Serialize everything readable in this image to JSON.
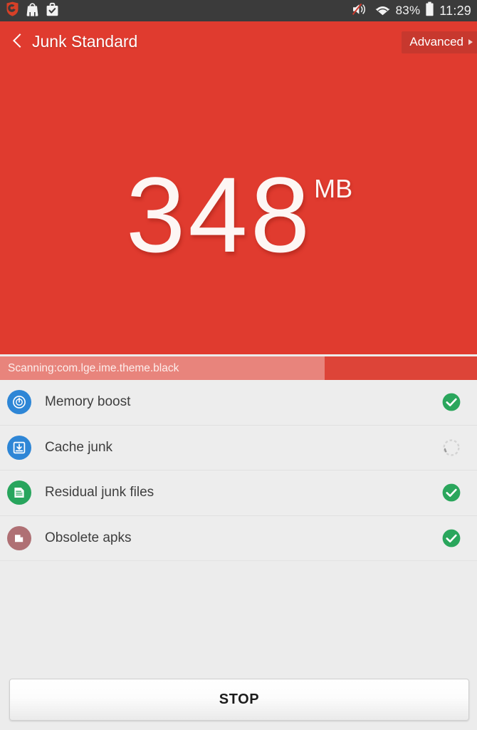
{
  "status_bar": {
    "notification_icons": [
      "shield-icon",
      "app-bag-icon",
      "briefcase-check-icon"
    ],
    "volume_icon": "volume-muted-icon",
    "wifi_icon": "wifi-icon",
    "battery_percent": "83%",
    "battery_icon": "battery-icon",
    "time": "11:29"
  },
  "header": {
    "back_icon": "back-chevron-icon",
    "title": "Junk Standard",
    "advanced_label": "Advanced",
    "advanced_caret": "caret-right-icon"
  },
  "hero": {
    "amount": "348",
    "unit": "MB",
    "background_color": "#e03b2f"
  },
  "progress": {
    "label": "Scanning:com.lge.ime.theme.black",
    "percent": 68,
    "fill_color": "#e8847c",
    "track_color": "#dd4438"
  },
  "tasks": [
    {
      "label": "Memory boost",
      "icon": "memory-boost-icon",
      "icon_color": "#2e86d6",
      "status": "done",
      "status_icon": "check-circle-icon",
      "status_color": "#2aa65c"
    },
    {
      "label": "Cache junk",
      "icon": "cache-junk-icon",
      "icon_color": "#2e86d6",
      "status": "scanning",
      "status_icon": "spinner-icon",
      "status_color": "#c9c9c9"
    },
    {
      "label": "Residual junk files",
      "icon": "residual-junk-icon",
      "icon_color": "#28a55d",
      "status": "done",
      "status_icon": "check-circle-icon",
      "status_color": "#2aa65c"
    },
    {
      "label": "Obsolete apks",
      "icon": "obsolete-apks-icon",
      "icon_color": "#af7074",
      "status": "done",
      "status_icon": "check-circle-icon",
      "status_color": "#2aa65c"
    }
  ],
  "footer": {
    "stop_label": "STOP"
  }
}
